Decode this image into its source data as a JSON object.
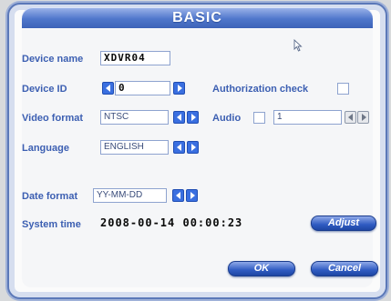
{
  "dialog": {
    "title": "BASIC"
  },
  "device_name": {
    "label": "Device name",
    "value": "XDVR04"
  },
  "device_id": {
    "label": "Device ID",
    "value": "0"
  },
  "authorization": {
    "label": "Authorization check",
    "checked": false
  },
  "video_format": {
    "label": "Video format",
    "value": "NTSC"
  },
  "audio": {
    "label": "Audio",
    "checked": false,
    "value": "1"
  },
  "language": {
    "label": "Language",
    "value": "ENGLISH"
  },
  "date_format": {
    "label": "Date format",
    "value": "YY-MM-DD"
  },
  "system_time": {
    "label": "System time",
    "value": "2008-00-14 00:00:23"
  },
  "buttons": {
    "adjust": "Adjust",
    "ok": "OK",
    "cancel": "Cancel"
  },
  "colors": {
    "accent": "#3c5fb2",
    "title_bar": "#5077cc",
    "button": "#2f5bc2"
  },
  "icons": [
    "arrow-left-icon",
    "arrow-right-icon",
    "checkbox-icon",
    "mouse-cursor-icon"
  ]
}
